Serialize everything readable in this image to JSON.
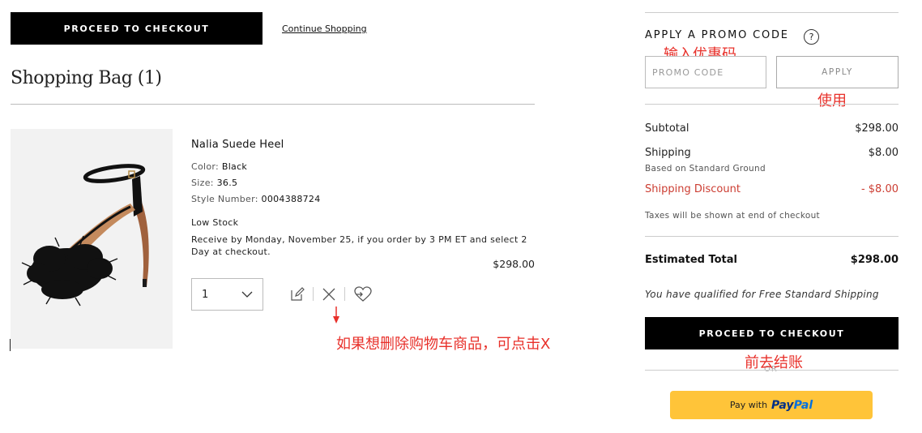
{
  "header": {
    "checkout_label": "PROCEED TO CHECKOUT",
    "continue_label": "Continue Shopping"
  },
  "bag": {
    "title": "Shopping Bag (1)"
  },
  "item": {
    "name": "Nalia Suede Heel",
    "color_label": "Color:",
    "color_value": "Black",
    "size_label": "Size:",
    "size_value": "36.5",
    "style_label": "Style Number:",
    "style_value": "0004388724",
    "stock": "Low Stock",
    "delivery": "Receive by Monday, November 25, if you order by 3 PM ET and select 2 Day at checkout.",
    "price": "$298.00",
    "quantity": "1",
    "icons": [
      "edit-icon",
      "close-icon",
      "wishlist-heart-icon"
    ]
  },
  "promo": {
    "heading": "APPLY A PROMO CODE",
    "help": "?",
    "placeholder": "PROMO CODE",
    "apply_label": "APPLY"
  },
  "summary": {
    "subtotal_label": "Subtotal",
    "subtotal_value": "$298.00",
    "shipping_label": "Shipping",
    "shipping_value": "$8.00",
    "shipping_sub": "Based on Standard Ground",
    "discount_label": "Shipping Discount",
    "discount_value": "- $8.00",
    "taxes_note": "Taxes will be shown at end of checkout",
    "total_label": "Estimated Total",
    "total_value": "$298.00",
    "free_shipping": "You have qualified for Free Standard Shipping",
    "checkout_label": "PROCEED TO CHECKOUT",
    "or": "OR",
    "paypal_with": "Pay with",
    "paypal_pay": "Pay",
    "paypal_pal": "Pal"
  },
  "annotations": {
    "promo_hint": "输入优惠码",
    "apply_hint": "使用",
    "delete_hint": "如果想删除购物车商品，可点击X",
    "checkout_hint": "前去结账",
    "color": "#e8302a"
  },
  "colors": {
    "black": "#000000",
    "discount_red": "#cc3d32",
    "paypal_yellow": "#ffc439",
    "paypal_dark_blue": "#003087",
    "paypal_light_blue": "#0070e0"
  }
}
